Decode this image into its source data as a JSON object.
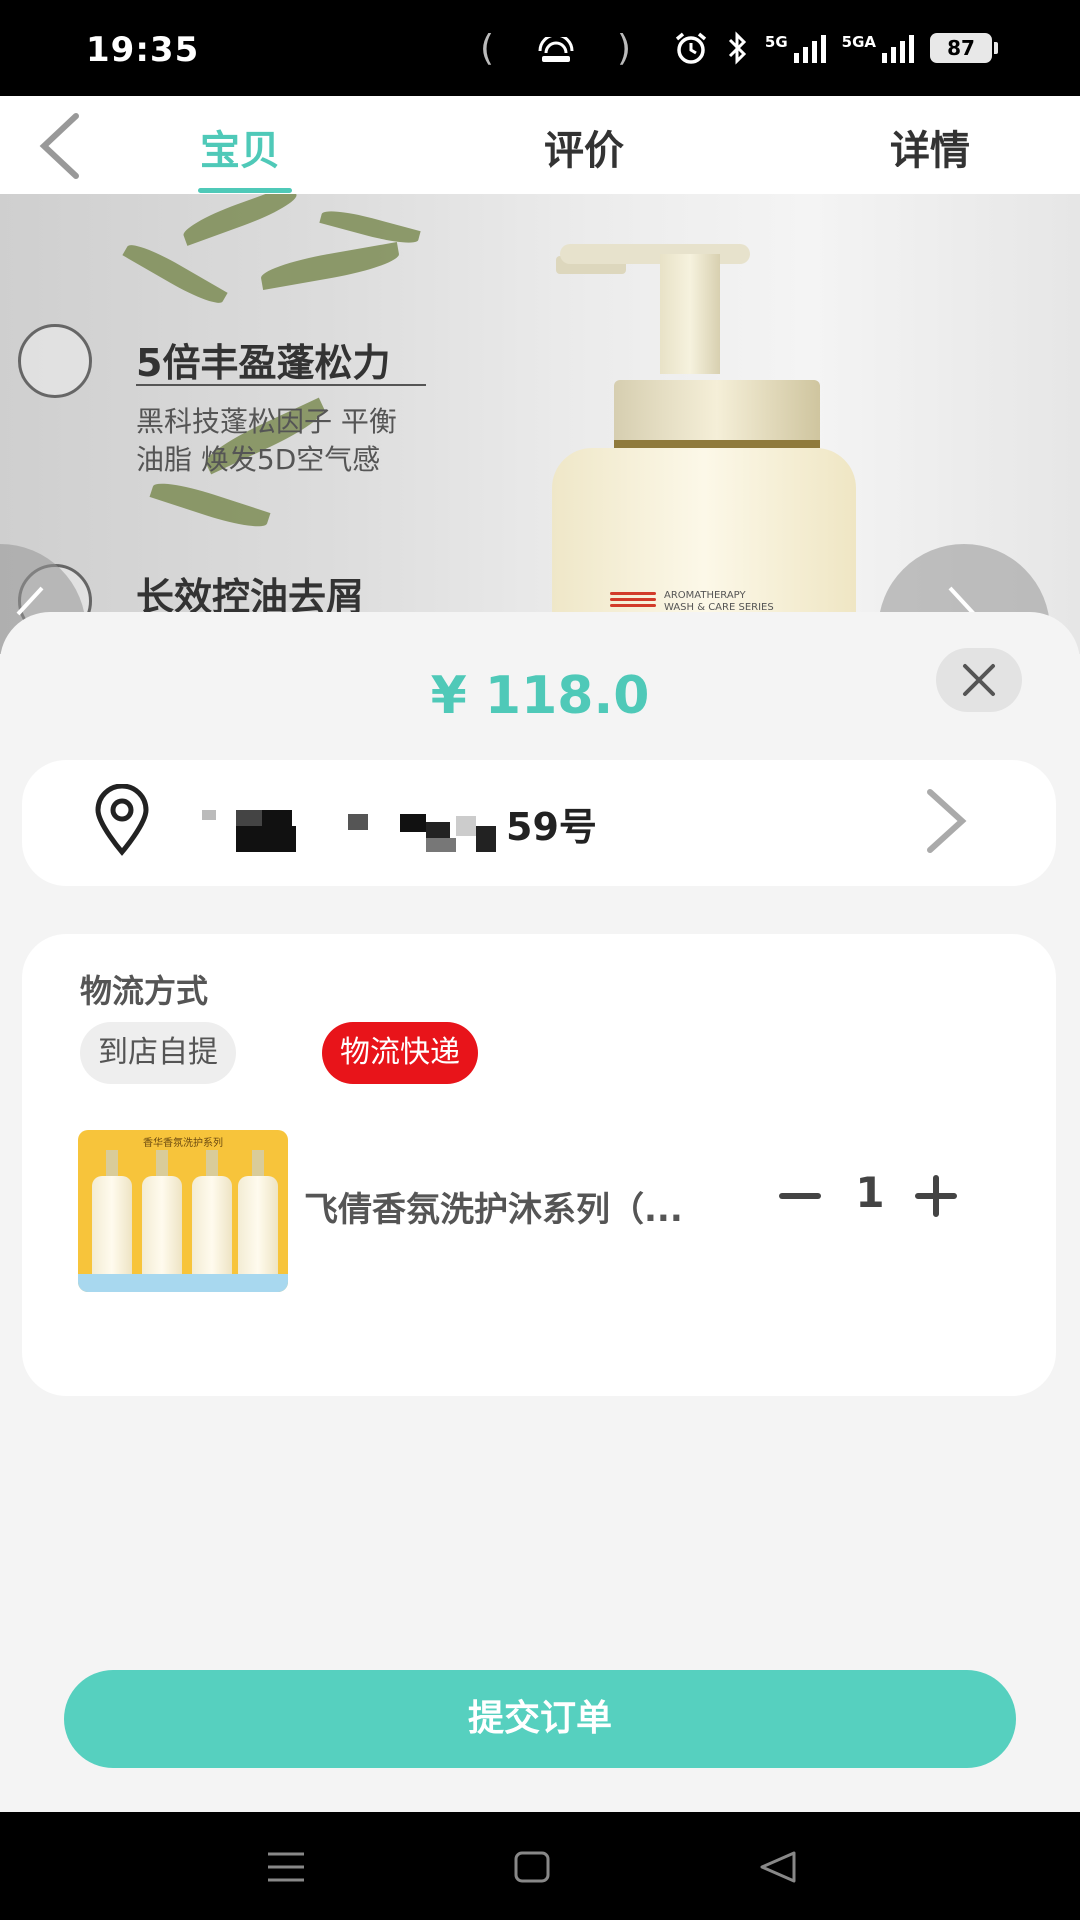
{
  "status_bar": {
    "time": "19:35",
    "center_left": "(",
    "center_right": ")",
    "signal1_label": "5G",
    "signal2_label": "5GA",
    "battery": "87",
    "icons": [
      "hotspot-icon",
      "alarm-icon",
      "bluetooth-icon",
      "signal-icon",
      "battery-icon"
    ]
  },
  "top_nav": {
    "tabs": [
      {
        "label": "宝贝",
        "active": true
      },
      {
        "label": "评价",
        "active": false
      },
      {
        "label": "详情",
        "active": false
      }
    ]
  },
  "banner": {
    "feature1_title": "5倍丰盈蓬松力",
    "feature1_line1": "黑科技蓬松因子 平衡",
    "feature1_line2": "油脂  焕发5D空气感",
    "feature2_title": "长效控油去屑",
    "bottle_text_line1": "AROMATHERAPY",
    "bottle_text_line2": "WASH & CARE SERIES"
  },
  "sheet": {
    "price": "¥ 118.0",
    "address_visible_text": "59号",
    "logistics_title": "物流方式",
    "logistics_options": [
      {
        "label": "到店自提",
        "selected": false
      },
      {
        "label": "物流快递",
        "selected": true
      }
    ],
    "product": {
      "thumb_title": "香华香氛洗护系列",
      "name": "飞倩香氛洗护沐系列（...",
      "quantity": "1"
    },
    "submit_label": "提交订单"
  },
  "colors": {
    "accent": "#4fc9b8",
    "submit": "#56d0bf",
    "express_red": "#e8141a"
  }
}
